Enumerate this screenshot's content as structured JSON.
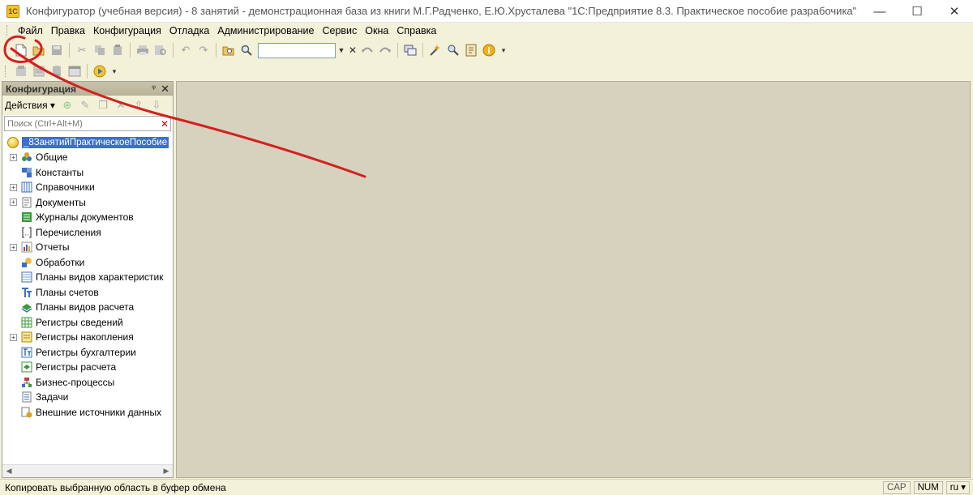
{
  "window": {
    "title": "Конфигуратор (учебная версия) - 8 занятий - демонстрационная база из книги М.Г.Радченко, Е.Ю.Хрусталева \"1С:Предприятие 8.3. Практическое пособие разрабочика\"",
    "app_icon": "1C",
    "controls": {
      "minimize": "—",
      "maximize": "☐",
      "close": "✕"
    }
  },
  "menu": {
    "items": [
      "Файл",
      "Правка",
      "Конфигурация",
      "Отладка",
      "Администрирование",
      "Сервис",
      "Окна",
      "Справка"
    ]
  },
  "toolbar1": {
    "icons": [
      "new-document-icon",
      "open-icon",
      "save-icon",
      "cut-icon",
      "copy-icon",
      "paste-icon",
      "print-icon",
      "preview-icon",
      "undo-icon",
      "redo-icon",
      "find-in-folder-icon",
      "search-icon",
      "search-combo",
      "find-prev-icon",
      "find-next-icon",
      "windows-icon",
      "wizard-icon",
      "syntax-helper-icon",
      "manual-icon",
      "info-icon"
    ],
    "search_value": ""
  },
  "toolbar2": {
    "icons": [
      "config-open-icon",
      "config-save-icon",
      "db-update-icon",
      "properties-icon",
      "run-debug-icon"
    ]
  },
  "config_panel": {
    "title": "Конфигурация",
    "actions_label": "Действия",
    "search_placeholder": "Поиск (Ctrl+Alt+M)",
    "root": "_8ЗанятийПрактическоеПособие",
    "nodes": [
      {
        "label": "Общие",
        "expandable": true,
        "icon": "common-icon"
      },
      {
        "label": "Константы",
        "expandable": false,
        "icon": "constants-icon"
      },
      {
        "label": "Справочники",
        "expandable": true,
        "icon": "catalogs-icon"
      },
      {
        "label": "Документы",
        "expandable": true,
        "icon": "documents-icon"
      },
      {
        "label": "Журналы документов",
        "expandable": false,
        "icon": "journals-icon"
      },
      {
        "label": "Перечисления",
        "expandable": false,
        "icon": "enums-icon"
      },
      {
        "label": "Отчеты",
        "expandable": true,
        "icon": "reports-icon"
      },
      {
        "label": "Обработки",
        "expandable": false,
        "icon": "dataprocessors-icon"
      },
      {
        "label": "Планы видов характеристик",
        "expandable": false,
        "icon": "chart-of-characteristic-types-icon"
      },
      {
        "label": "Планы счетов",
        "expandable": false,
        "icon": "chart-of-accounts-icon"
      },
      {
        "label": "Планы видов расчета",
        "expandable": false,
        "icon": "chart-of-calculation-types-icon"
      },
      {
        "label": "Регистры сведений",
        "expandable": false,
        "icon": "information-registers-icon"
      },
      {
        "label": "Регистры накопления",
        "expandable": true,
        "icon": "accumulation-registers-icon"
      },
      {
        "label": "Регистры бухгалтерии",
        "expandable": false,
        "icon": "accounting-registers-icon"
      },
      {
        "label": "Регистры расчета",
        "expandable": false,
        "icon": "calculation-registers-icon"
      },
      {
        "label": "Бизнес-процессы",
        "expandable": false,
        "icon": "business-processes-icon"
      },
      {
        "label": "Задачи",
        "expandable": false,
        "icon": "tasks-icon"
      },
      {
        "label": "Внешние источники данных",
        "expandable": false,
        "icon": "external-data-sources-icon"
      }
    ]
  },
  "statusbar": {
    "text": "Копировать выбранную область в буфер обмена",
    "cap": "CAP",
    "num": "NUM",
    "lang": "ru"
  },
  "colors": {
    "annotation": "#d42020",
    "selection": "#3c6fd0",
    "workspace": "#d6d2bd"
  }
}
